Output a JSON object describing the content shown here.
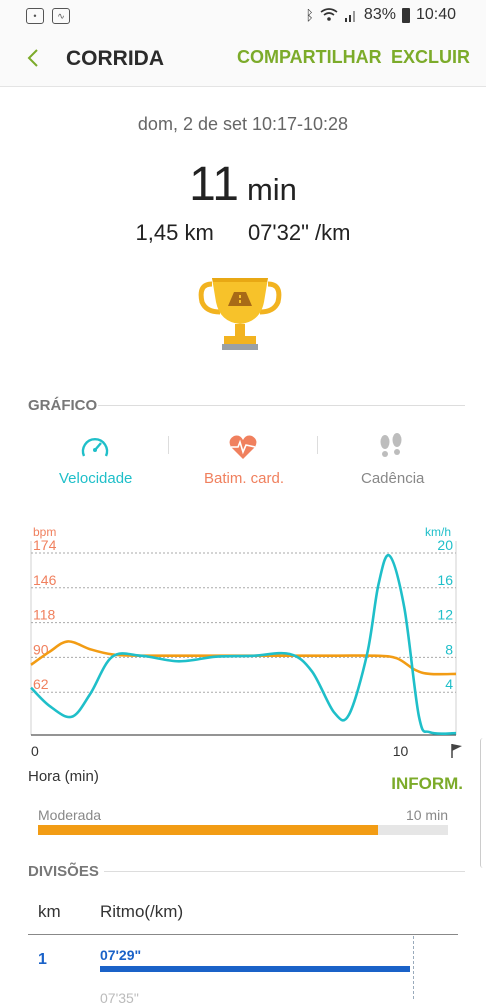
{
  "status_bar": {
    "left_icons": [
      "sos-icon",
      "activity-icon"
    ],
    "right_icons": [
      "bluetooth-icon",
      "wifi-icon",
      "signal-icon"
    ],
    "battery": "83%",
    "time": "10:40"
  },
  "app_bar": {
    "title": "CORRIDA",
    "share_label": "COMPARTILHAR",
    "delete_label": "EXCLUIR",
    "accent_color": "#7cab2a"
  },
  "summary": {
    "datetime": "dom, 2 de set 10:17-10:28",
    "duration_value": "11",
    "duration_unit": "min",
    "distance": "1,45 km",
    "pace": "07'32\" /km"
  },
  "graph_section": {
    "title": "GRÁFICO",
    "tabs": [
      {
        "label": "Velocidade",
        "icon": "speedometer-icon",
        "color": "#1fbfc9"
      },
      {
        "label": "Batim. card.",
        "icon": "heart-rate-icon",
        "color": "#f0805e"
      },
      {
        "label": "Cadência",
        "icon": "footsteps-icon",
        "color": "#888888"
      }
    ]
  },
  "chart_data": {
    "type": "line",
    "left_axis_label": "bpm",
    "right_axis_label": "km/h",
    "left_ticks": [
      "174",
      "146",
      "118",
      "90",
      "62"
    ],
    "right_ticks": [
      "20",
      "16",
      "12",
      "8",
      "4"
    ],
    "x_ticks": [
      "0",
      "10"
    ],
    "xlabel": "Hora (min)",
    "xlim": [
      0,
      11.5
    ],
    "ylim_left": [
      34,
      174
    ],
    "ylim_right": [
      0,
      20
    ],
    "grid": true,
    "series": [
      {
        "axis": "left",
        "color": "#f29c14",
        "x": [
          0,
          0.5,
          1.0,
          1.6,
          2.2,
          3.0,
          5.0,
          8.0,
          9.3,
          9.9,
          10.4,
          10.8,
          11.5
        ],
        "y": [
          88,
          98,
          106,
          100,
          96,
          95,
          95,
          95,
          95,
          93,
          84,
          81,
          81
        ]
      },
      {
        "axis": "right",
        "color": "#1fbfc9",
        "x": [
          0,
          0.5,
          1.1,
          1.6,
          2.2,
          3.0,
          4.0,
          5.0,
          6.0,
          7.0,
          7.6,
          8.2,
          8.6,
          9.1,
          9.4,
          9.7,
          10.1,
          10.5,
          10.8,
          11.5
        ],
        "y": [
          5.2,
          3.2,
          2.0,
          4.5,
          8.6,
          8.7,
          8.1,
          8.6,
          8.7,
          8.9,
          7.0,
          2.5,
          2.2,
          9.0,
          16.5,
          19.7,
          14.0,
          2.0,
          0.3,
          0.2
        ]
      }
    ]
  },
  "report": {
    "inform_label": "INFORM.",
    "intensity_label": "Moderada",
    "intensity_time": "10 min",
    "intensity_fraction": 0.83,
    "intensity_color": "#f29c14"
  },
  "splits": {
    "title": "DIVISÕES",
    "col_km": "km",
    "col_pace": "Ritmo(/km)",
    "rows": [
      {
        "km": "1",
        "pace": "07'29\"",
        "fraction": 0.75
      }
    ],
    "next_partial": "07'35\""
  }
}
